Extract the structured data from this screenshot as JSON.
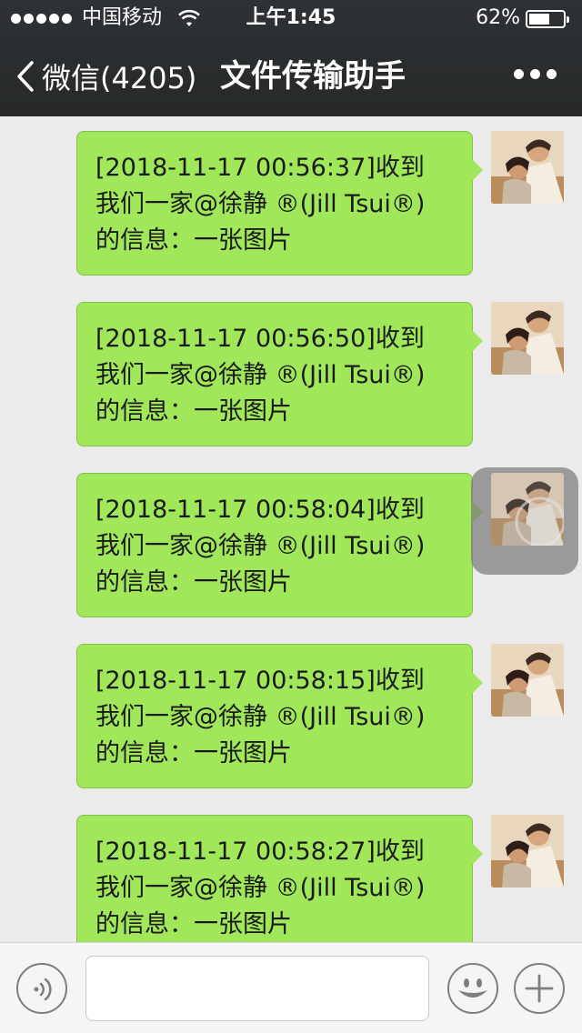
{
  "status_bar": {
    "carrier": "中国移动",
    "time": "上午1:45",
    "battery_percent_text": "62%",
    "battery_level": 0.62
  },
  "nav": {
    "back_label": "微信(4205)",
    "title": "文件传输助手",
    "more_icon": "more-dots-icon"
  },
  "messages": [
    {
      "line1": "[2018-11-17 00:56:37]收到",
      "line2": "我们一家@徐静 ®(Jill Tsui®)",
      "line3": "的信息：一张图片"
    },
    {
      "line1": "[2018-11-17 00:56:50]收到",
      "line2": "我们一家@徐静 ®(Jill Tsui®)",
      "line3": "的信息：一张图片"
    },
    {
      "line1": "[2018-11-17 00:58:04]收到",
      "line2": "我们一家@徐静 ®(Jill Tsui®)",
      "line3": "的信息：一张图片"
    },
    {
      "line1": "[2018-11-17 00:58:15]收到",
      "line2": "我们一家@徐静 ®(Jill Tsui®)",
      "line3": "的信息：一张图片"
    },
    {
      "line1": "[2018-11-17 00:58:27]收到",
      "line2": "我们一家@徐静 ®(Jill Tsui®)",
      "line3": "的信息：一张图片"
    }
  ],
  "input_bar": {
    "voice_icon": "voice-icon",
    "emoji_icon": "emoji-icon",
    "plus_icon": "plus-icon",
    "text_value": ""
  },
  "colors": {
    "bubble": "#a0e75a",
    "header": "#2b2d2f",
    "chat_background": "#ebebeb"
  }
}
